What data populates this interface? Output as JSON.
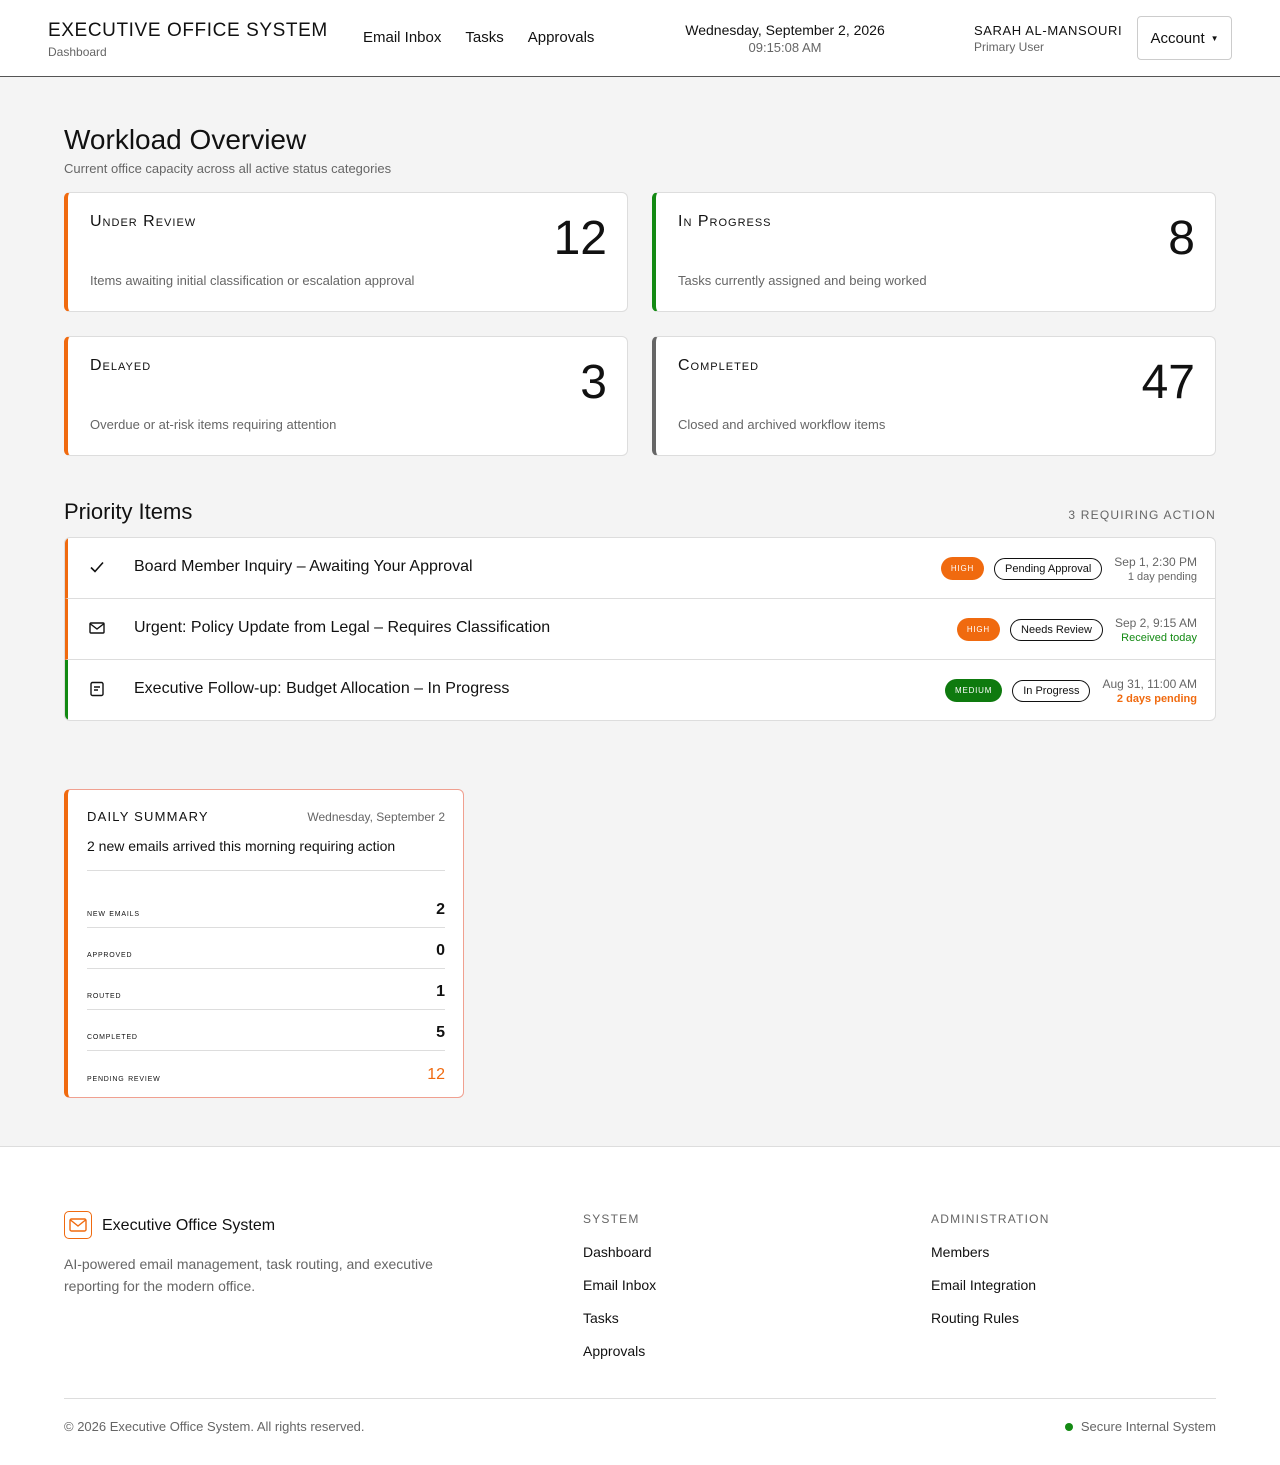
{
  "header": {
    "title": "EXECUTIVE OFFICE SYSTEM",
    "subtitle": "Dashboard",
    "nav": [
      "Email Inbox",
      "Tasks",
      "Approvals"
    ],
    "date": "Wednesday, September 2, 2026",
    "time": "09:15:08 AM",
    "user_name": "SARAH AL-MANSOURI",
    "user_role": "Primary User",
    "account_label": "Account"
  },
  "overview": {
    "title": "Workload Overview",
    "subtitle": "Current office capacity across all active status categories",
    "cards": [
      {
        "label": "Under Review",
        "count": "12",
        "desc": "Items awaiting initial classification or escalation approval",
        "accent": "#f06a0f"
      },
      {
        "label": "In Progress",
        "count": "8",
        "desc": "Tasks currently assigned and being worked",
        "accent": "#138a13"
      },
      {
        "label": "Delayed",
        "count": "3",
        "desc": "Overdue or at-risk items requiring attention",
        "accent": "#f06a0f"
      },
      {
        "label": "Completed",
        "count": "47",
        "desc": "Closed and archived workflow items",
        "accent": "#666666"
      }
    ]
  },
  "priority": {
    "title": "Priority Items",
    "count_label": "3 REQUIRING ACTION",
    "items": [
      {
        "icon": "check-icon",
        "text": "Board Member Inquiry – Awaiting Your Approval",
        "priority": "HIGH",
        "priority_color": "#f06a0f",
        "status": "Pending Approval",
        "date": "Sep 1, 2:30 PM",
        "note": "1 day pending",
        "note_color": "#666666",
        "accent": "#f06a0f"
      },
      {
        "icon": "mail-icon",
        "text": "Urgent: Policy Update from Legal – Requires Classification",
        "priority": "HIGH",
        "priority_color": "#f06a0f",
        "status": "Needs Review",
        "date": "Sep 2, 9:15 AM",
        "note": "Received today",
        "note_color": "#138a13",
        "accent": "#f06a0f"
      },
      {
        "icon": "document-icon",
        "text": "Executive Follow-up: Budget Allocation – In Progress",
        "priority": "MEDIUM",
        "priority_color": "#0e7a0e",
        "status": "In Progress",
        "date": "Aug 31, 11:00 AM",
        "note": "2 days pending",
        "note_color": "#f06a0f",
        "accent": "#138a13"
      }
    ]
  },
  "summary": {
    "title": "DAILY SUMMARY",
    "date": "Wednesday, September 2",
    "message": "2 new emails arrived this morning requiring action",
    "rows": [
      {
        "label": "New Emails",
        "value": "2",
        "color": "#111111"
      },
      {
        "label": "Approved",
        "value": "0",
        "color": "#111111"
      },
      {
        "label": "Routed",
        "value": "1",
        "color": "#111111"
      },
      {
        "label": "Completed",
        "value": "5",
        "color": "#111111"
      },
      {
        "label": "Pending Review",
        "value": "12",
        "color": "#f06a0f"
      }
    ]
  },
  "footer": {
    "brand": "Executive Office System",
    "description": "AI-powered email management, task routing, and executive reporting for the modern office.",
    "system_title": "SYSTEM",
    "system_links": [
      "Dashboard",
      "Email Inbox",
      "Tasks",
      "Approvals"
    ],
    "admin_title": "ADMINISTRATION",
    "admin_links": [
      "Members",
      "Email Integration",
      "Routing Rules"
    ],
    "copyright": "© 2026 Executive Office System. All rights reserved.",
    "secure_label": "Secure Internal System",
    "secure_color": "#138a13"
  }
}
